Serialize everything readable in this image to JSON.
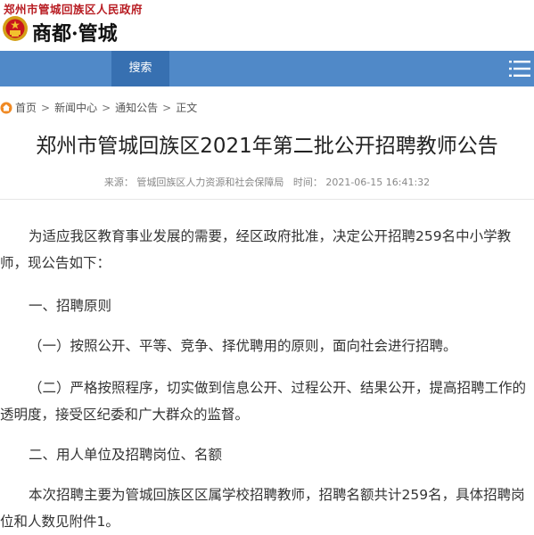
{
  "header": {
    "gov_name": "郑州市管城回族区人民政府",
    "logo_text": "商都·管城",
    "emblem_icon": "national-emblem-icon"
  },
  "nav": {
    "search_label": "搜索",
    "menu_icon": "hamburger-menu-icon",
    "bar_color": "#5089c8",
    "active_color": "#3770b1"
  },
  "breadcrumb": {
    "home": "首页",
    "items": [
      "新闻中心",
      "通知公告",
      "正文"
    ],
    "separator": ">"
  },
  "article": {
    "title": "郑州市管城回族区2021年第二批公开招聘教师公告",
    "source_label": "来源：",
    "source": "管城回族区人力资源和社会保障局",
    "time_label": "时间：",
    "time": "2021-06-15 16:41:32",
    "paragraphs": [
      "为适应我区教育事业发展的需要，经区政府批准，决定公开招聘259名中小学教师，现公告如下：",
      "一、招聘原则",
      "（一）按照公开、平等、竞争、择优聘用的原则，面向社会进行招聘。",
      "（二）严格按照程序，切实做到信息公开、过程公开、结果公开，提高招聘工作的透明度，接受区纪委和广大群众的监督。",
      "二、用人单位及招聘岗位、名额",
      "本次招聘主要为管城回族区区属学校招聘教师，招聘名额共计259名，具体招聘岗位和人数见附件1。"
    ]
  }
}
